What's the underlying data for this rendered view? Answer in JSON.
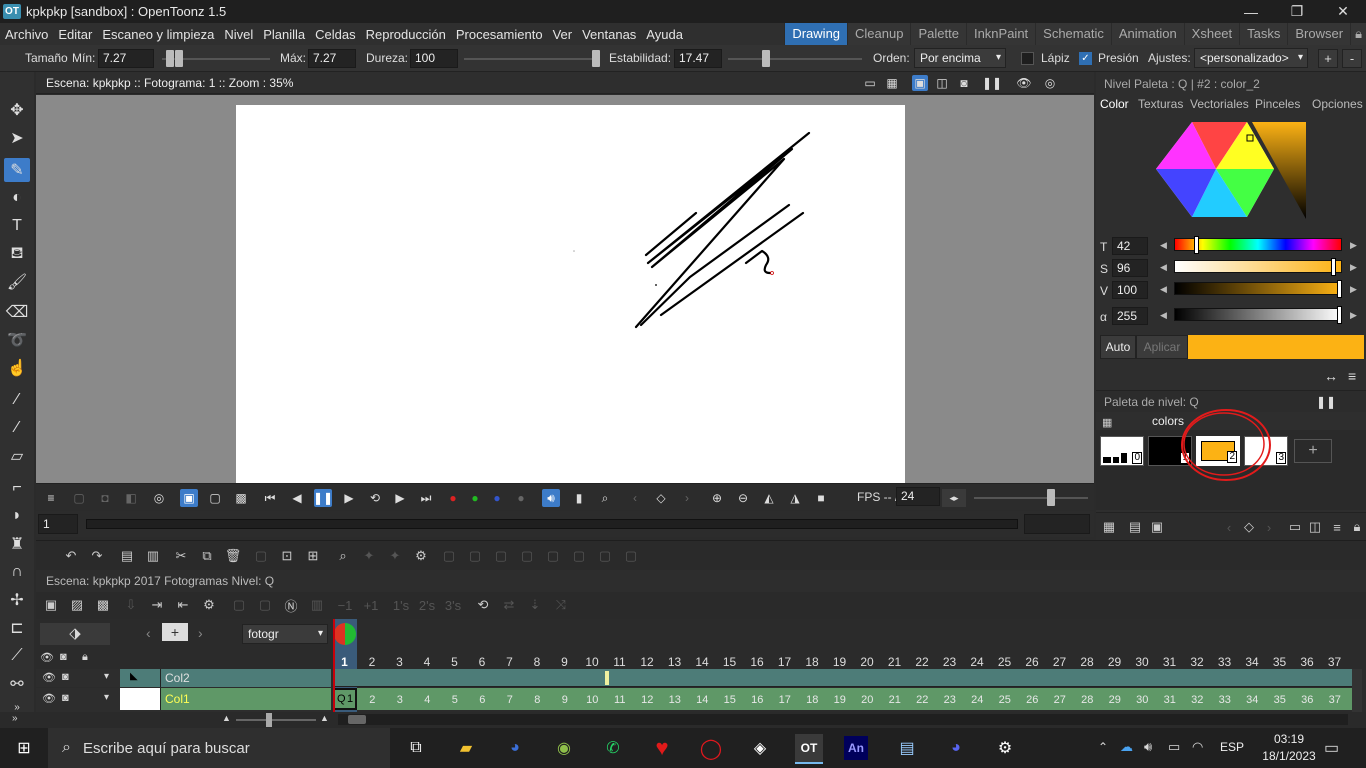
{
  "window": {
    "title": "kpkpkp [sandbox] : OpenToonz 1.5",
    "logo": "OT"
  },
  "menu": [
    "Archivo",
    "Editar",
    "Escaneo y limpieza",
    "Nivel",
    "Planilla",
    "Celdas",
    "Reproducción",
    "Procesamiento",
    "Ver",
    "Ventanas",
    "Ayuda"
  ],
  "rooms": [
    "Drawing",
    "Cleanup",
    "Palette",
    "InknPaint",
    "Schematic",
    "Animation",
    "Xsheet",
    "Tasks",
    "Browser"
  ],
  "active_room": "Drawing",
  "tool_options": {
    "size_label": "Tamaño",
    "min_label": "Mín:",
    "min_value": "7.27",
    "max_label": "Máx:",
    "max_value": "7.27",
    "hardness_label": "Dureza:",
    "hardness_value": "100",
    "stability_label": "Estabilidad:",
    "stability_value": "17.47",
    "order_label": "Orden:",
    "order_value": "Por encima",
    "pencil_label": "Lápiz",
    "pencil_checked": false,
    "pressure_label": "Presión",
    "pressure_checked": true,
    "settings_label": "Ajustes:",
    "settings_value": "<personalizado>",
    "plus": "+",
    "minus": "-"
  },
  "viewer": {
    "title": "Escena: kpkpkp  ::  Fotograma: 1  ::  Zoom : 35%"
  },
  "playback": {
    "fps_label": "FPS -- /",
    "fps_value": "24",
    "frame": "1"
  },
  "style_editor": {
    "title": "Nivel Paleta : Q | #2 : color_2",
    "tabs": [
      "Color",
      "Texturas",
      "Vectoriales",
      "Pinceles",
      "Opciones"
    ],
    "active_tab": "Color",
    "channels": [
      {
        "label": "T",
        "value": "42",
        "knob_fraction": 0.12
      },
      {
        "label": "S",
        "value": "96",
        "knob_fraction": 0.96
      },
      {
        "label": "V",
        "value": "100",
        "knob_fraction": 1.0
      },
      {
        "label": "α",
        "value": "255",
        "knob_fraction": 1.0
      }
    ],
    "auto_label": "Auto",
    "apply_label": "Aplicar",
    "current_color": "#fcb214"
  },
  "level_palette": {
    "title": "Paleta de nivel: Q",
    "page_tab": "colors",
    "chips": [
      {
        "index": "0",
        "color": "#ffffff"
      },
      {
        "index": "1",
        "color": "#000000"
      },
      {
        "index": "2",
        "color": "#fcb214"
      },
      {
        "index": "3",
        "color": "#ffffff"
      }
    ],
    "add": "+"
  },
  "xsheet": {
    "header": "Escena: kpkpkp     2017 Fotogramas  Nivel: Q",
    "frame_zoom_label": "fotogr",
    "frame_numbers": [
      "1",
      "2",
      "3",
      "4",
      "5",
      "6",
      "7",
      "8",
      "9",
      "10",
      "11",
      "12",
      "13",
      "14",
      "15",
      "16",
      "17",
      "18",
      "19",
      "20",
      "21",
      "22",
      "23",
      "24",
      "25",
      "26",
      "27",
      "28",
      "29",
      "30",
      "31",
      "32",
      "33",
      "34",
      "35",
      "36",
      "37"
    ],
    "columns": [
      {
        "name": "Col2"
      },
      {
        "name": "Col1",
        "first_cell": "Q",
        "first_cell_num": "1"
      }
    ],
    "step_minus": "−1",
    "step_plus": "+1",
    "step_ts": "1's",
    "step_2s": "2's",
    "step_3s": "3's"
  },
  "taskbar": {
    "search_placeholder": "Escribe aquí para buscar",
    "lang": "ESP",
    "time": "03:19",
    "date": "18/1/2023"
  },
  "colors": {
    "accent": "#3d7cc9",
    "column_teal": "#4d7c78",
    "column_green": "#5f9867",
    "playhead": "#c8000a",
    "annotation_red": "#e21b1b"
  }
}
